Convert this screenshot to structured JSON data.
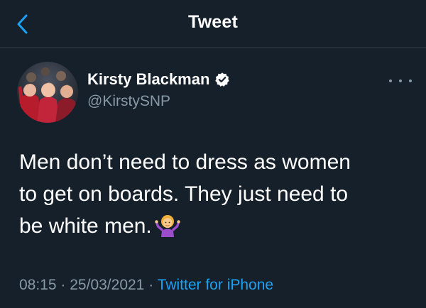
{
  "header": {
    "title": "Tweet",
    "back_icon": "chevron-left-icon",
    "accent_color": "#1da1f2"
  },
  "author": {
    "display_name": "Kirsty Blackman",
    "handle": "@KirstySNP",
    "verified_icon": "verified-badge-icon",
    "avatar_icon": "profile-photo"
  },
  "tweet": {
    "lines": [
      "Men don’t need to dress as women",
      "to get on boards. They just need to",
      "be white men."
    ],
    "emoji_icon": "person-shrugging-emoji",
    "time": "08:15",
    "separator": "·",
    "date": "25/03/2021",
    "source": "Twitter for iPhone"
  },
  "menu": {
    "more_icon": "more-horizontal-icon"
  },
  "colors": {
    "background": "#15202b",
    "divider": "#38444d",
    "secondary_text": "#8899a6",
    "link": "#1da1f2"
  }
}
